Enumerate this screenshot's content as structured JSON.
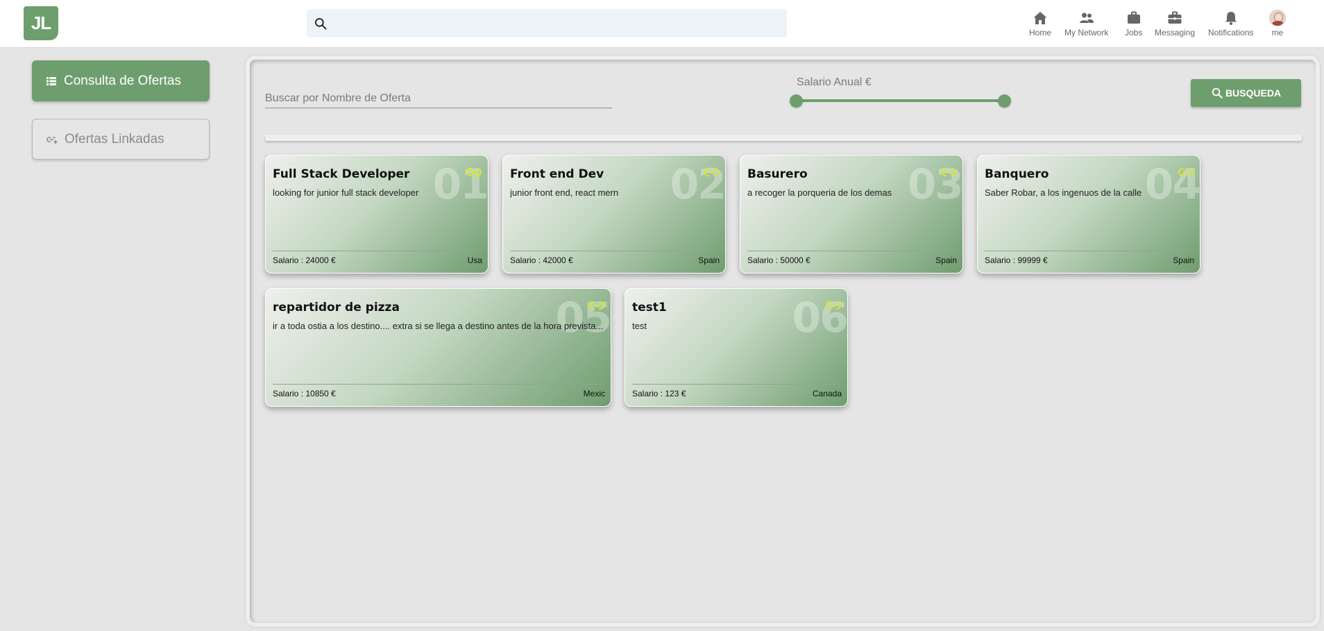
{
  "header": {
    "logo_text": "JL",
    "search_placeholder": "",
    "nav": [
      {
        "label": "Home",
        "icon": "home-icon"
      },
      {
        "label": "My Network",
        "icon": "people-icon"
      },
      {
        "label": "Jobs",
        "icon": "briefcase-icon"
      },
      {
        "label": "Messaging",
        "icon": "toolbox-icon"
      },
      {
        "label": "Notifications",
        "icon": "bell-icon"
      },
      {
        "label": "me",
        "icon": "avatar"
      }
    ]
  },
  "sidebar": {
    "consulta_label": "Consulta de Ofertas",
    "linkadas_label": "Ofertas Linkadas"
  },
  "filters": {
    "name_placeholder": "Buscar por Nombre de Oferta",
    "salary_label": "Salario Anual €",
    "search_button": "BUSQUEDA"
  },
  "colors": {
    "accent": "#6e9e6d",
    "link_icon": "#d8e82a"
  },
  "offers": [
    {
      "num": "01",
      "title": "Full Stack Developer",
      "desc": "looking for junior full stack developer",
      "salary": "Salario : 24000 €",
      "country": "Usa",
      "linked": false
    },
    {
      "num": "02",
      "title": "Front end Dev",
      "desc": "junior front end, react mern",
      "salary": "Salario : 42000 €",
      "country": "Spain",
      "linked": true
    },
    {
      "num": "03",
      "title": "Basurero",
      "desc": "a recoger la porqueria de los demas",
      "salary": "Salario : 50000 €",
      "country": "Spain",
      "linked": true
    },
    {
      "num": "04",
      "title": "Banquero",
      "desc": "Saber Robar, a los ingenuos de la calle",
      "salary": "Salario : 99999 €",
      "country": "Spain",
      "linked": true
    },
    {
      "num": "05",
      "title": "repartidor de pizza",
      "desc": "ir a toda ostia a los destino.... extra si se llega a destino antes de la hora prevista...",
      "salary": "Salario : 10850 €",
      "country": "Mexic",
      "linked": true
    },
    {
      "num": "06",
      "title": "test1",
      "desc": "test",
      "salary": "Salario : 123 €",
      "country": "Canada",
      "linked": true
    }
  ]
}
